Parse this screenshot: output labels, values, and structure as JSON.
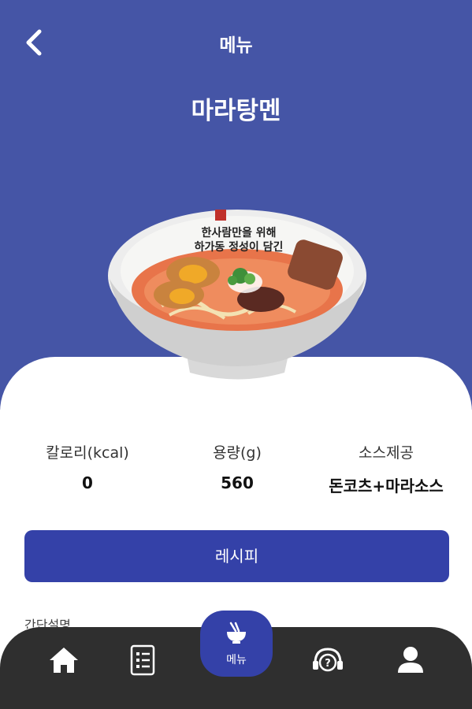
{
  "header": {
    "title": "메뉴",
    "back_icon": "chevron-left-icon"
  },
  "dish": {
    "name": "마라탕멘",
    "bowl_text_line1": "한사람만을 위해",
    "bowl_text_line2": "하가동 정성이 담긴"
  },
  "stats": {
    "calories": {
      "label": "칼로리(kcal)",
      "value": "0"
    },
    "volume": {
      "label": "용량(g)",
      "value": "560"
    },
    "sauce": {
      "label": "소스제공",
      "value": "돈코츠+마라소스"
    }
  },
  "recipe_button": {
    "label": "레시피"
  },
  "description": {
    "label": "간단설명"
  },
  "bottom_nav": {
    "items": [
      {
        "icon": "home-icon"
      },
      {
        "icon": "list-icon"
      },
      {
        "icon": "ramen-bowl-icon",
        "label": "메뉴",
        "active": true
      },
      {
        "icon": "help-headset-icon"
      },
      {
        "icon": "user-icon"
      }
    ]
  },
  "colors": {
    "hero_bg": "#4555a6",
    "accent": "#3441a8",
    "nav_bg": "#2f2f2f",
    "text_dark": "#111111",
    "white": "#ffffff"
  }
}
